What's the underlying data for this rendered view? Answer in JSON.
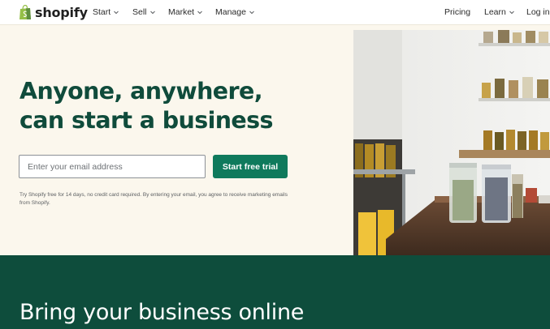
{
  "brand": {
    "name": "shopify",
    "logo_icon": "shopping-bag-icon",
    "color": "#95bf47"
  },
  "nav": {
    "left": [
      {
        "label": "Start",
        "has_dropdown": true
      },
      {
        "label": "Sell",
        "has_dropdown": true
      },
      {
        "label": "Market",
        "has_dropdown": true
      },
      {
        "label": "Manage",
        "has_dropdown": true
      }
    ],
    "right": [
      {
        "label": "Pricing",
        "has_dropdown": false
      },
      {
        "label": "Learn",
        "has_dropdown": true
      },
      {
        "label": "Log in",
        "has_dropdown": false
      }
    ]
  },
  "hero": {
    "headline_line1": "Anyone, anywhere,",
    "headline_line2": "can start a business",
    "email_placeholder": "Enter your email address",
    "cta_label": "Start free trial",
    "disclaimer": "Try Shopify free for 14 days, no credit card required. By entering your email, you agree to receive marketing emails from Shopify.",
    "accent_color": "#0f4b3b",
    "cta_color": "#0f7a5c"
  },
  "band": {
    "title": "Bring your business online",
    "color": "#0e4d3c"
  }
}
